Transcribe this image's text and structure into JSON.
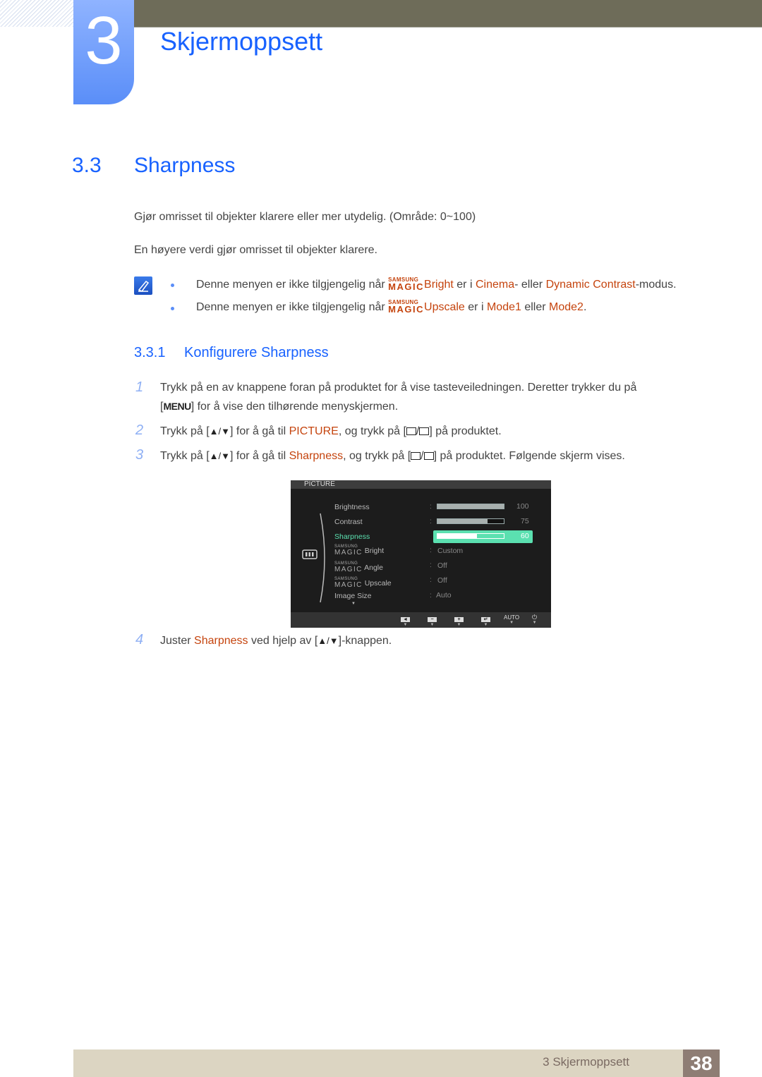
{
  "chapter": {
    "number": "3",
    "title": "Skjermoppsett"
  },
  "section": {
    "number": "3.3",
    "title": "Sharpness"
  },
  "intro": [
    "Gjør omrisset til objekter klarere eller mer utydelig. (Område: 0~100)",
    "En høyere verdi gjør omrisset til objekter klarere."
  ],
  "notes": [
    {
      "prefix": "Denne menyen er ikke tilgjengelig når",
      "magic_top": "SAMSUNG",
      "magic_bottom": "MAGIC",
      "feature": "Bright",
      "mid1": "er i",
      "val1": "Cinema",
      "mid2": "- eller",
      "val2": "Dynamic Contrast",
      "suffix": "-modus."
    },
    {
      "prefix": "Denne menyen er ikke tilgjengelig når",
      "magic_top": "SAMSUNG",
      "magic_bottom": "MAGIC",
      "feature": "Upscale",
      "mid1": "er i",
      "val1": "Mode1",
      "mid2": "eller",
      "val2": "Mode2",
      "suffix": "."
    }
  ],
  "subsection": {
    "number": "3.3.1",
    "title": "Konfigurere Sharpness"
  },
  "steps": [
    {
      "num": "1",
      "line1": "Trykk på en av knappene foran på produktet for å vise tasteveiledningen. Deretter trykker du på",
      "key": "MENU",
      "line2": "for å vise den tilhørende menyskjermen."
    },
    {
      "num": "2",
      "pre": "Trykk på [",
      "arrows": "▲/▼",
      "mid": "] for å gå til",
      "target": "PICTURE",
      "post": ", og trykk på [",
      "end": "] på produktet."
    },
    {
      "num": "3",
      "pre": "Trykk på [",
      "arrows": "▲/▼",
      "mid": "] for å gå til",
      "target": "Sharpness",
      "post": ", og trykk på [",
      "end": "] på produktet. Følgende skjerm vises."
    },
    {
      "num": "4",
      "pre": "Juster",
      "target": "Sharpness",
      "mid": "ved hjelp av [",
      "arrows": "▲/▼",
      "end": "]-knappen."
    }
  ],
  "osd": {
    "header": "PICTURE",
    "items": [
      {
        "label": "Brightness",
        "value": "100",
        "bar": 1.0
      },
      {
        "label": "Contrast",
        "value": "75",
        "bar": 0.75
      },
      {
        "label": "Sharpness",
        "value": "60",
        "bar": 0.6,
        "selected": true
      },
      {
        "magic_top": "SAMSUNG",
        "magic_bottom": "MAGIC",
        "label": "Bright",
        "value": "Custom"
      },
      {
        "magic_top": "SAMSUNG",
        "magic_bottom": "MAGIC",
        "label": "Angle",
        "value": "Off"
      },
      {
        "magic_top": "SAMSUNG",
        "magic_bottom": "MAGIC",
        "label": "Upscale",
        "value": "Off"
      },
      {
        "label": "Image Size",
        "value": "Auto"
      }
    ],
    "colon": ":",
    "footer_buttons": [
      "◄",
      "−",
      "+",
      "↵",
      "AUTO",
      "⏻"
    ],
    "more_arrow": "▼",
    "highlight_color": "#5be0b0",
    "selected_text_color": "#5be0b0"
  },
  "footer": {
    "label": "3 Skjermoppsett",
    "page": "38"
  },
  "colors": {
    "heading": "#1862ff",
    "highlight": "#c5440e",
    "tab": "#5a8ef8",
    "topbar": "#6e6c59"
  }
}
